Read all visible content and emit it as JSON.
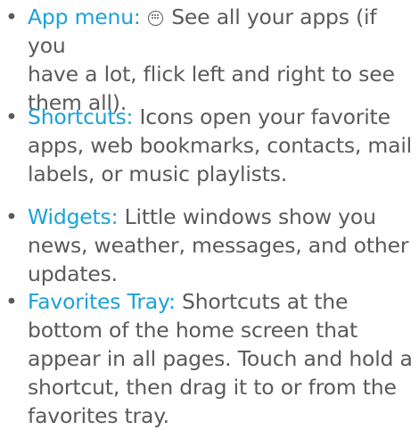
{
  "items": [
    {
      "term": "App menu:",
      "icon": "app-menu-icon",
      "lines": [
        " See all your apps (if you",
        "have a lot, flick left and right to see",
        "them all)."
      ]
    },
    {
      "term": "Shortcuts:",
      "lines": [
        " Icons open your favorite",
        "apps, web bookmarks, contacts, mail",
        "labels, or music playlists."
      ]
    },
    {
      "term": "Widgets:",
      "lines": [
        " Little windows show you",
        "news, weather, messages, and other",
        "updates."
      ]
    },
    {
      "term": "Favorites Tray:",
      "lines": [
        " Shortcuts at the",
        "bottom of the home screen that",
        "appear in all pages. Touch and hold a",
        "shortcut, then drag it to or from the",
        "favorites tray."
      ]
    }
  ],
  "colors": {
    "term": "#1ba1d8",
    "body_text": "#5a5a5a"
  }
}
